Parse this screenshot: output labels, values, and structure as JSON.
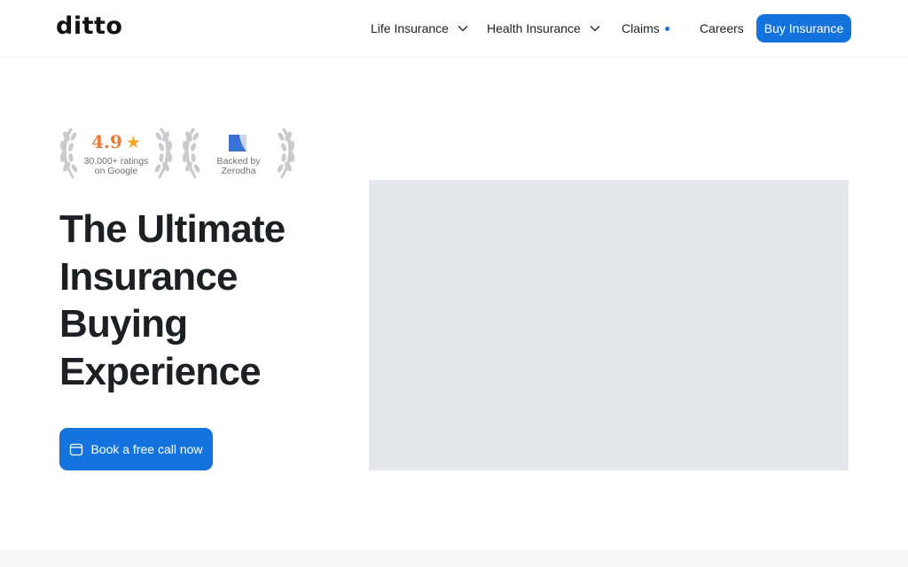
{
  "header": {
    "logo": "ditto",
    "nav": {
      "life": "Life Insurance",
      "health": "Health Insurance",
      "claims": "Claims",
      "careers": "Careers"
    },
    "cta": "Buy Insurance"
  },
  "badges": {
    "rating": {
      "score": "4.9",
      "line1": "30,000+ ratings",
      "line2": "on Google"
    },
    "backer": {
      "line1": "Backed by",
      "line2": "Zerodha"
    }
  },
  "hero": {
    "title": "The Ultimate Insurance Buying Experience",
    "cta": "Book a free call now"
  },
  "colors": {
    "accent": "#1473dc",
    "rating": "#ec7b3a",
    "star": "#f4a623",
    "media_placeholder": "#e4e7eb"
  },
  "icons": [
    "chevron-down-icon",
    "calendar-icon",
    "star-icon",
    "laurel-icon",
    "zerodha-logo"
  ]
}
